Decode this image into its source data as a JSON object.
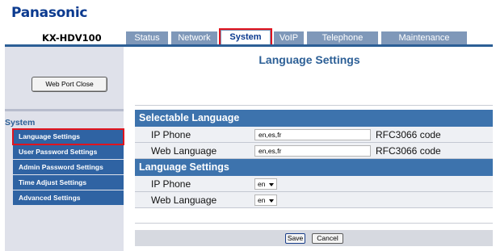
{
  "header": {
    "brand": "Panasonic",
    "model": "KX-HDV100"
  },
  "tabs": [
    {
      "label": "Status",
      "active": false
    },
    {
      "label": "Network",
      "active": false
    },
    {
      "label": "System",
      "active": true
    },
    {
      "label": "VoIP",
      "active": false
    },
    {
      "label": "Telephone",
      "active": false
    },
    {
      "label": "Maintenance",
      "active": false
    }
  ],
  "sidebar": {
    "web_port_button": "Web Port Close",
    "heading": "System",
    "items": [
      {
        "label": "Language Settings",
        "active": true
      },
      {
        "label": "User Password Settings",
        "active": false
      },
      {
        "label": "Admin Password Settings",
        "active": false
      },
      {
        "label": "Time Adjust Settings",
        "active": false
      },
      {
        "label": "Advanced Settings",
        "active": false
      }
    ]
  },
  "main": {
    "title": "Language Settings",
    "selectable_section": {
      "heading": "Selectable Language",
      "ip_phone_label": "IP Phone",
      "ip_phone_value": "en,es,fr",
      "ip_phone_note": "RFC3066 code",
      "web_label": "Web Language",
      "web_value": "en,es,fr",
      "web_note": "RFC3066 code"
    },
    "language_section": {
      "heading": "Language Settings",
      "ip_phone_label": "IP Phone",
      "ip_phone_selected": "en",
      "web_label": "Web Language",
      "web_selected": "en"
    },
    "buttons": {
      "save": "Save",
      "cancel": "Cancel"
    }
  },
  "colors": {
    "brand_blue": "#0b3a8f",
    "tab_inactive": "#7f98b9",
    "section_header": "#3d73ad",
    "sidebar_item": "#2f63a3",
    "highlight_red": "#e0141e"
  }
}
